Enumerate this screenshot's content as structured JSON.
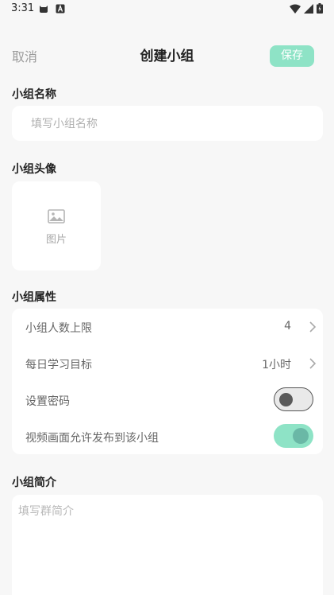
{
  "status_bar": {
    "time": "3:31",
    "left_icons": [
      "cat-icon",
      "a-box-icon"
    ],
    "right_icons": [
      "wifi-icon",
      "signal-icon",
      "battery-icon"
    ]
  },
  "header": {
    "cancel_label": "取消",
    "title": "创建小组",
    "save_label": "保存"
  },
  "group_name": {
    "section_label": "小组名称",
    "placeholder": "填写小组名称",
    "value": ""
  },
  "group_avatar": {
    "section_label": "小组头像",
    "icon": "image-icon",
    "placeholder_label": "图片"
  },
  "attributes": {
    "section_label": "小组属性",
    "rows": [
      {
        "label": "小组人数上限",
        "value": "4",
        "control": "chevron"
      },
      {
        "label": "每日学习目标",
        "value": "1小时",
        "control": "chevron"
      },
      {
        "label": "设置密码",
        "control": "toggle",
        "state": "off"
      },
      {
        "label": "视频画面允许发布到该小组",
        "control": "toggle",
        "state": "on"
      }
    ]
  },
  "intro": {
    "section_label": "小组简介",
    "placeholder": "填写群简介",
    "value": ""
  },
  "colors": {
    "accent": "#8ee3c6",
    "background": "#f7f7f7",
    "card": "#ffffff"
  }
}
